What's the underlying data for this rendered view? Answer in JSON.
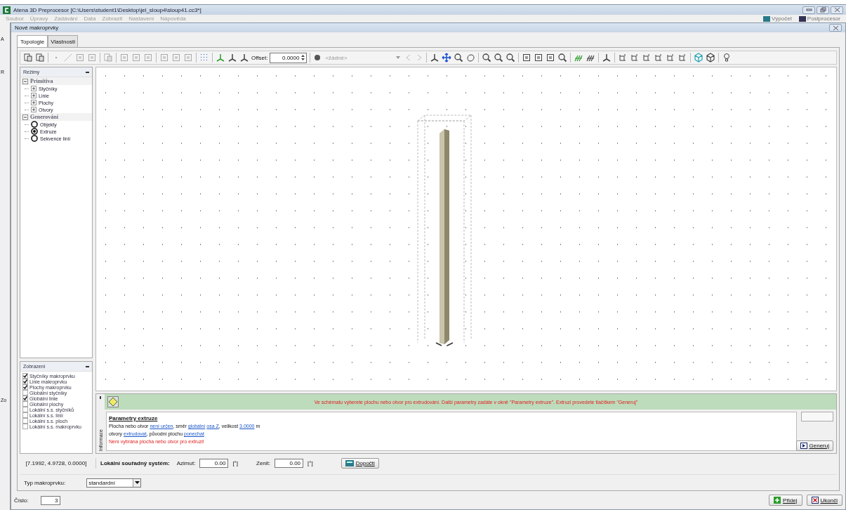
{
  "app": {
    "title": "Atena 3D Preprocesor [C:\\Users\\student1\\Desktop\\jel_sloup4\\sloup41.cc3*]",
    "menu": [
      {
        "label": "Soubor",
        "disabled": true
      },
      {
        "label": "Úpravy",
        "disabled": true
      },
      {
        "label": "Zadávání",
        "disabled": true
      },
      {
        "label": "Data",
        "disabled": true
      },
      {
        "label": "Zobrazit",
        "disabled": true
      },
      {
        "label": "Nastavení",
        "disabled": true
      },
      {
        "label": "Nápověda",
        "disabled": true
      }
    ],
    "right_buttons": [
      "Výpočet",
      "Postprocesor"
    ],
    "edge_labels": [
      "A",
      "R",
      "Zo"
    ]
  },
  "dialog": {
    "title": "Nové makroprvky",
    "tabs": [
      {
        "label": "Topologie",
        "selected": true
      },
      {
        "label": "Vlastnosti",
        "selected": false
      }
    ],
    "toolbar": {
      "offset_label": "Offset:",
      "offset_value": "0.0000",
      "layer_value": "<žádné>"
    },
    "modes_panel": {
      "title": "Režimy",
      "tree": [
        {
          "label": "Primitiva",
          "expanded": true,
          "children": [
            {
              "label": "Styčníky",
              "kind": "expandable"
            },
            {
              "label": "Linie",
              "kind": "expandable"
            },
            {
              "label": "Plochy",
              "kind": "expandable"
            },
            {
              "label": "Otvory",
              "kind": "expandable"
            }
          ]
        },
        {
          "label": "Generování",
          "expanded": true,
          "children": [
            {
              "label": "Objekty",
              "kind": "radio",
              "selected": false
            },
            {
              "label": "Extruze",
              "kind": "radio",
              "selected": true
            },
            {
              "label": "Sekvence linií",
              "kind": "radio",
              "selected": false
            }
          ]
        }
      ]
    },
    "display_panel": {
      "title": "Zobrazení",
      "items": [
        {
          "label": "Styčníky makroprvku",
          "checked": true
        },
        {
          "label": "Linie makroprvku",
          "checked": true
        },
        {
          "label": "Plochy makroprvku",
          "checked": true
        },
        {
          "label": "Globální styčníky",
          "checked": false
        },
        {
          "label": "Globální linie",
          "checked": true
        },
        {
          "label": "Globální plochy",
          "checked": false
        },
        {
          "label": "Lokální s.s. styčníků",
          "checked": false
        },
        {
          "label": "Lokální s.s. linií",
          "checked": false
        },
        {
          "label": "Lokální s.s. ploch",
          "checked": false
        },
        {
          "label": "Lokální s.s. makroprvku",
          "checked": false
        }
      ]
    },
    "info": {
      "side_label": "Informace",
      "message": "Ve schématu vyberete plochu nebo otvor pro extrudování. Další parametry zadáte v okně \"Parametry extruze\". Extruzi provedete tlačítkem \"Generuj\"",
      "heading": "Parametry extruze",
      "lines": [
        {
          "kind": "normal",
          "parts": [
            {
              "text": "Plocha nebo otvor ",
              "kind": "text"
            },
            {
              "text": "není určen",
              "kind": "link"
            },
            {
              "text": ", směr ",
              "kind": "text"
            },
            {
              "text": "globální",
              "kind": "link"
            },
            {
              "text": "osa Z",
              "kind": "link"
            },
            {
              "text": ", velikost ",
              "kind": "text"
            },
            {
              "text": "3.0000",
              "kind": "link"
            },
            {
              "text": " m",
              "kind": "text"
            }
          ]
        },
        {
          "kind": "normal",
          "parts": [
            {
              "text": "otvory ",
              "kind": "text"
            },
            {
              "text": "extrudovat",
              "kind": "link"
            },
            {
              "text": ", původní plochu ",
              "kind": "text"
            },
            {
              "text": "ponechat",
              "kind": "link"
            }
          ]
        },
        {
          "kind": "error",
          "parts": [
            {
              "text": "Není vybrána plocha nebo otvor pro extruzi!",
              "kind": "text"
            }
          ]
        }
      ],
      "button": "Generuj"
    },
    "coordinates": "[7.1992, 4.9728, 0.0000]",
    "local_cs": {
      "label": "Lokální souřadný systém:",
      "azimut_label": "Azimut:",
      "azimut_value": "0.00",
      "azimut_unit": "[°]",
      "zenit_label": "Zenit:",
      "zenit_value": "0.00",
      "zenit_unit": "[°]",
      "button": "Dopočti"
    },
    "macro_type": {
      "label": "Typ makroprvku:",
      "value": "standardní"
    },
    "number": {
      "label": "Číslo:",
      "value": "3"
    },
    "buttons": [
      {
        "label": "Přidej",
        "kind": "add"
      },
      {
        "label": "Ukonči",
        "kind": "close"
      }
    ]
  }
}
